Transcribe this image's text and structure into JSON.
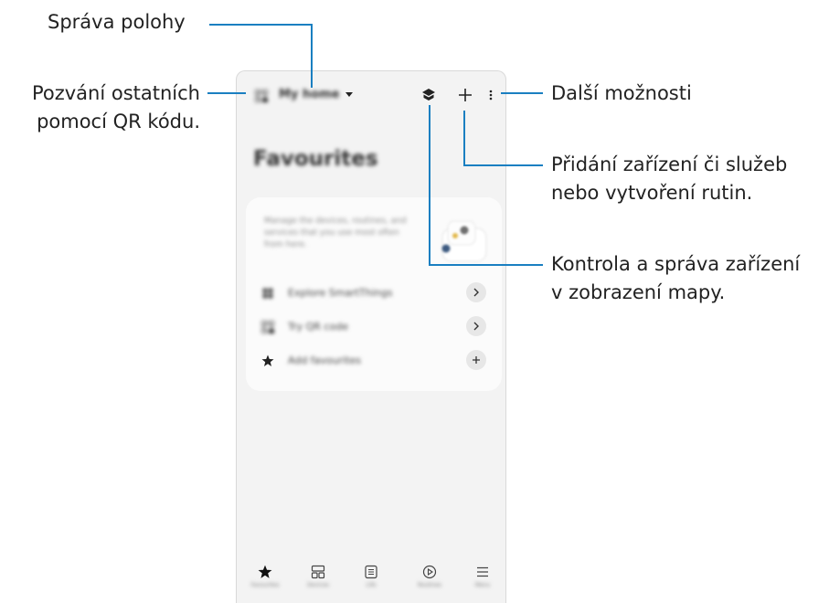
{
  "callouts": {
    "location": "Správa polohy",
    "invite_line1": "Pozvání ostatních",
    "invite_line2": "pomocí QR kódu.",
    "more": "Další možnosti",
    "add_line1": "Přidání zařízení či služeb",
    "add_line2": "nebo vytvoření rutin.",
    "map_line1": "Kontrola a správa zařízení",
    "map_line2": "v zobrazení mapy."
  },
  "app": {
    "home_name": "My home",
    "favourites_title": "Favourites",
    "card_text": "Manage the devices, routines, and services that you use most often from here.",
    "rows": [
      {
        "label": "Explore SmartThings",
        "icon": "explore-icon",
        "action": "chevron-right-icon"
      },
      {
        "label": "Try QR code",
        "icon": "qr-home-icon",
        "action": "chevron-right-icon"
      },
      {
        "label": "Add favourites",
        "icon": "star-add-icon",
        "action": "plus-icon"
      }
    ],
    "nav": [
      {
        "label": "Favourites",
        "icon": "star-icon"
      },
      {
        "label": "Devices",
        "icon": "devices-icon"
      },
      {
        "label": "Life",
        "icon": "life-icon"
      },
      {
        "label": "Routines",
        "icon": "routines-icon"
      },
      {
        "label": "Menu",
        "icon": "menu-icon"
      }
    ],
    "accent": "#1a7fc1"
  }
}
